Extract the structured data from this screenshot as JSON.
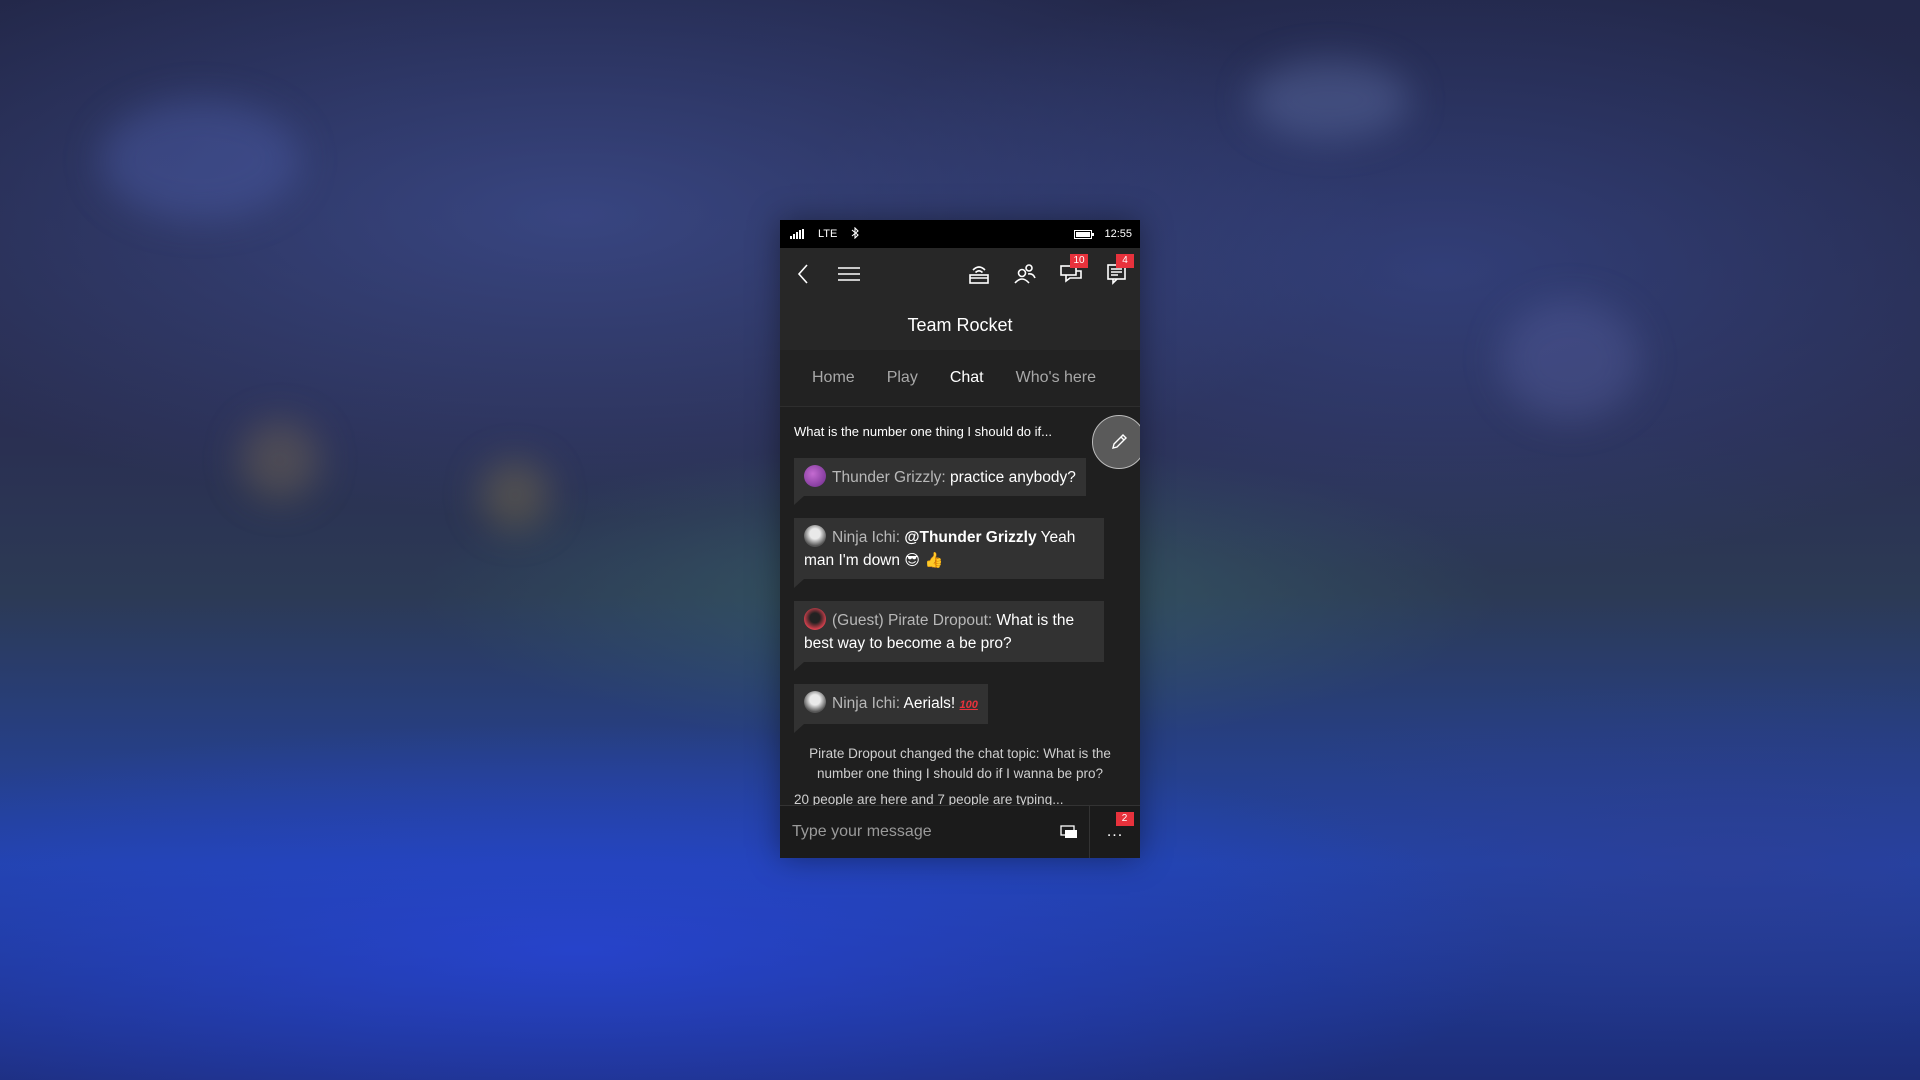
{
  "status_bar": {
    "network": "LTE",
    "time": "12:55"
  },
  "app_bar": {
    "messages_badge": "10",
    "notifications_badge": "4"
  },
  "title": "Team Rocket",
  "tabs": [
    {
      "label": "Home",
      "active": false
    },
    {
      "label": "Play",
      "active": false
    },
    {
      "label": "Chat",
      "active": true
    },
    {
      "label": "Who's here",
      "active": false
    }
  ],
  "chat": {
    "topic_preview": "What is the number one thing I should do if...",
    "messages": [
      {
        "author": "Thunder Grizzly:",
        "text": "practice anybody?"
      },
      {
        "author": "Ninja Ichi:",
        "mention": "@Thunder Grizzly",
        "text": " Yeah man I'm down ",
        "emoji": "😎 👍"
      },
      {
        "author": "(Guest) Pirate Dropout:",
        "text": "What is the best way to become a be pro?"
      },
      {
        "author": "Ninja Ichi:",
        "text": "Aerials!",
        "emoji": "100"
      }
    ],
    "system_message": "Pirate Dropout changed the chat topic: What is the number one thing I should do if I wanna be pro?",
    "typing_status": "20 people are here and 7 people are typing..."
  },
  "composer": {
    "placeholder": "Type your message",
    "more_label": "...",
    "more_badge": "2"
  },
  "colors": {
    "badge": "#e8323c",
    "bubble": "#323232",
    "background": "#1f1f1f"
  }
}
